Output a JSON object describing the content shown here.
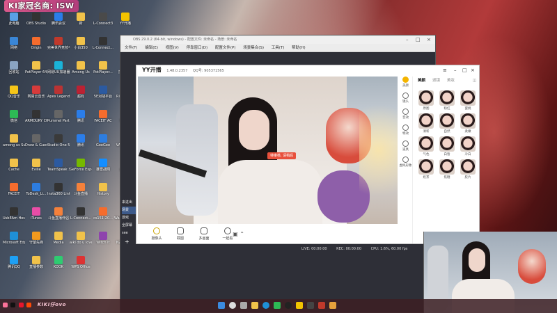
{
  "overlay_title": "KI家冠名商: ISW",
  "desktop_icons": [
    {
      "label": "此电脑",
      "color": "#5aa0e6"
    },
    {
      "label": "OBS Studio",
      "color": "#333"
    },
    {
      "label": "腾讯会议",
      "color": "#2b7de9"
    },
    {
      "label": "新",
      "color": "#f1c24a"
    },
    {
      "label": "L-Connect3",
      "color": "#4a4a4a"
    },
    {
      "label": "YY开播",
      "color": "#f4c400"
    },
    {
      "label": "网络",
      "color": "#3a86d6"
    },
    {
      "label": "Origin",
      "color": "#f56c2d"
    },
    {
      "label": "完美世界竞技平台",
      "color": "#c0392b"
    },
    {
      "label": "小白350",
      "color": "#f1c24a"
    },
    {
      "label": "L-Connect...",
      "color": "#333"
    },
    {
      "label": "",
      "color": "#555"
    },
    {
      "label": "回收站",
      "color": "#8aa4c2"
    },
    {
      "label": "PotPlayer 64 bit",
      "color": "#f1c24a"
    },
    {
      "label": "网易UU加速器",
      "color": "#1ab3d8"
    },
    {
      "label": "Among Us",
      "color": "#f1c24a"
    },
    {
      "label": "PotPlayer...",
      "color": "#f1c24a"
    },
    {
      "label": "控制面板",
      "color": "#4a90d9"
    },
    {
      "label": "QQ音乐",
      "color": "#f5c518"
    },
    {
      "label": "网易云音乐",
      "color": "#d63b3b"
    },
    {
      "label": "Apex Legends",
      "color": "#b33"
    },
    {
      "label": "超有",
      "color": "#b23"
    },
    {
      "label": "5E对战平台",
      "color": "#2c5aa0"
    },
    {
      "label": "Riot Client",
      "color": "#d43c3c"
    },
    {
      "label": "微信",
      "color": "#2dbb55"
    },
    {
      "label": "ARMOURY CRATE",
      "color": "#333"
    },
    {
      "label": "Pummel Party",
      "color": "#666"
    },
    {
      "label": "腾讯",
      "color": "#2b7de9"
    },
    {
      "label": "FACEIT AC",
      "color": "#f56c2d"
    },
    {
      "label": "Steam",
      "color": "#1b2838"
    },
    {
      "label": "among us SuperNe...",
      "color": "#f1c24a"
    },
    {
      "label": "Draw & Guess",
      "color": "#666"
    },
    {
      "label": "Studio One 5",
      "color": "#3a3a3a"
    },
    {
      "label": "腾讯",
      "color": "#2b7de9"
    },
    {
      "label": "GeeGee",
      "color": "#2d7de0"
    },
    {
      "label": "VALORANT",
      "color": "#fa4454"
    },
    {
      "label": "Cache",
      "color": "#f1c24a"
    },
    {
      "label": "Evilie",
      "color": "#f1c24a"
    },
    {
      "label": "TeamSpeak 3",
      "color": "#2c5aa0"
    },
    {
      "label": "GeForce Experience",
      "color": "#76b900"
    },
    {
      "label": "暴雪战网",
      "color": "#148eff"
    },
    {
      "label": "gidbrg",
      "color": "#f1c24a"
    },
    {
      "label": "FACEIT",
      "color": "#f56c2d"
    },
    {
      "label": "ToDesk_Li...",
      "color": "#2d7de0"
    },
    {
      "label": "Insta360 Link Co...",
      "color": "#333"
    },
    {
      "label": "斗鱼直播",
      "color": "#f5813b"
    },
    {
      "label": "History",
      "color": "#f1c24a"
    },
    {
      "label": "Feige",
      "color": "#d33"
    },
    {
      "label": "UsbEAm Hosts Edit...",
      "color": "#333"
    },
    {
      "label": "iTunes",
      "color": "#e94da6"
    },
    {
      "label": "斗鱼直播伴侣",
      "color": "#f5813b"
    },
    {
      "label": "L-Connect...",
      "color": "#333"
    },
    {
      "label": "cs151-20...",
      "color": "#f56c2d"
    },
    {
      "label": "Wallpaper Engine:...",
      "color": "#1f6fb5"
    },
    {
      "label": "Microsoft Edge",
      "color": "#1f8fd6"
    },
    {
      "label": "守望先锋",
      "color": "#f29a1f"
    },
    {
      "label": "Media",
      "color": "#f1c24a"
    },
    {
      "label": "aiki do u love me 2...",
      "color": "#f1c24a"
    },
    {
      "label": "Witch It",
      "color": "#8e44ad"
    },
    {
      "label": "NZXT CAM",
      "color": "#7a2fb5"
    },
    {
      "label": "腾讯QQ",
      "color": "#1ea0f5"
    },
    {
      "label": "直播参数",
      "color": "#f1c24a"
    },
    {
      "label": "KOOK",
      "color": "#2ecc71"
    },
    {
      "label": "WPS Office",
      "color": "#d33"
    }
  ],
  "obs": {
    "title_text": "OBS 29.0.2 (64-bit, windows) - 配置文件: 未命名 - 场景: 未命名",
    "menu": [
      "文件(F)",
      "编辑(E)",
      "视图(V)",
      "停靠窗口(D)",
      "配置文件(P)",
      "场景集合(S)",
      "工具(T)",
      "帮助(H)"
    ],
    "side_items": [
      "来进出",
      "场景",
      "游戏",
      "全屏幕",
      "see"
    ],
    "status": {
      "live": "LIVE: 00:00:00",
      "rec": "REC: 00:00:00",
      "cpu": "CPU: 1.6%, 60.00 fps"
    }
  },
  "yy": {
    "logo": "YY开播",
    "version": "1.48.0.2357",
    "qq_label": "QQ号: 905371565",
    "preview_label": "待审核, 请稍后",
    "bottom_tools": [
      "摄像头",
      "截图",
      "多画面",
      "一起看"
    ],
    "side_items": [
      "美颜",
      "镜头",
      "音效",
      "特效",
      "道具",
      "虚拟形象"
    ],
    "tabs": [
      "美颜",
      "滤镜",
      "美妆"
    ],
    "filters": [
      "原图",
      "粉红",
      "蜜桃",
      "清新",
      "自然",
      "柔嫩",
      "气色",
      "白皙",
      "冷白",
      "奶茶",
      "焦糖",
      "胶片"
    ]
  },
  "taskbar": {
    "streamer_name": "KIKI仔ovo"
  }
}
